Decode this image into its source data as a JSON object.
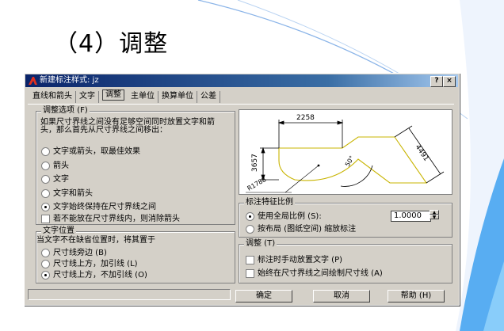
{
  "slide": {
    "title": "（4）调整"
  },
  "dialog": {
    "title": "新建标注样式: jz",
    "help_btn": "?",
    "close_btn": "×",
    "tabs": [
      {
        "label": "直线和箭头",
        "active": false
      },
      {
        "label": "文字",
        "active": false
      },
      {
        "label": "调整",
        "active": true
      },
      {
        "label": "主单位",
        "active": false
      },
      {
        "label": "换算单位",
        "active": false
      },
      {
        "label": "公差",
        "active": false
      }
    ],
    "fit_options": {
      "label": "调整选项 (F)",
      "description": "如果尺寸界线之间没有足够空间同时放置文字和箭头，那么首先从尺寸界线之间移出：",
      "options": [
        {
          "label": "文字或箭头，取最佳效果",
          "selected": false
        },
        {
          "label": "箭头",
          "selected": false
        },
        {
          "label": "文字",
          "selected": false
        },
        {
          "label": "文字和箭头",
          "selected": false
        },
        {
          "label": "文字始终保持在尺寸界线之间",
          "selected": true
        }
      ],
      "suppress_arrows": {
        "label": "若不能放在尺寸界线内，则消除箭头",
        "checked": false
      }
    },
    "text_placement": {
      "label": "文字位置",
      "description": "当文字不在缺省位置时，将其置于",
      "options": [
        {
          "label": "尺寸线旁边 (B)",
          "selected": false
        },
        {
          "label": "尺寸线上方，加引线 (L)",
          "selected": false
        },
        {
          "label": "尺寸线上方，不加引线 (O)",
          "selected": true
        }
      ]
    },
    "preview": {
      "dims": [
        "2258",
        "3657",
        "4491",
        "50°",
        "R1788"
      ]
    },
    "scale": {
      "label": "标注特征比例",
      "use_overall": "使用全局比例 (S):",
      "overall_value": "1.0000",
      "scale_to_layout": "按布局 (图纸空间) 缩放标注",
      "use_overall_selected": true
    },
    "fine_tuning": {
      "label": "调整 (T)",
      "manual_place": "标注时手动放置文字 (P)",
      "always_draw": "始终在尺寸界线之间绘制尺寸线 (A)"
    },
    "buttons": {
      "ok": "确定",
      "cancel": "取消",
      "help": "帮助 (H)"
    },
    "colors": {
      "titlebar_start": "#0a246a",
      "titlebar_end": "#a6caf0",
      "face": "#d4d0c8"
    }
  }
}
